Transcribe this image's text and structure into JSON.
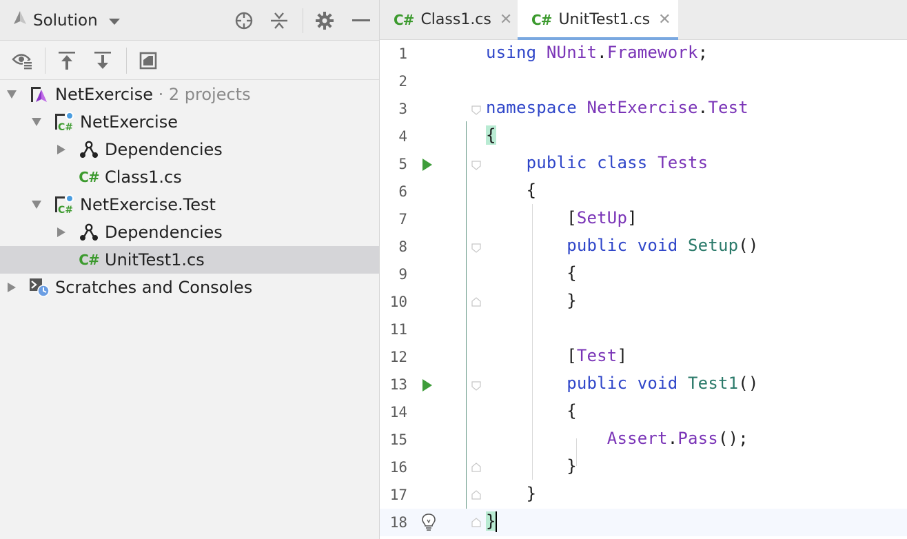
{
  "explorer": {
    "title": "Solution",
    "header_icons": [
      "locate-icon",
      "collapse-all-icon",
      "gear-icon",
      "minimize-icon"
    ],
    "toolbar_icons": [
      "show-options-icon",
      "move-up-icon",
      "move-down-icon",
      "preview-icon"
    ],
    "tree": [
      {
        "label": "NetExercise",
        "suffix": " · 2 projects",
        "icon": "solution-icon",
        "expanded": true
      },
      {
        "label": "NetExercise",
        "icon": "csharp-project-icon",
        "expanded": true
      },
      {
        "label": "Dependencies",
        "icon": "dependencies-icon",
        "expanded": false
      },
      {
        "label": "Class1.cs",
        "icon": "csharp-file-icon"
      },
      {
        "label": "NetExercise.Test",
        "icon": "csharp-project-icon",
        "expanded": true
      },
      {
        "label": "Dependencies",
        "icon": "dependencies-icon",
        "expanded": false
      },
      {
        "label": "UnitTest1.cs",
        "icon": "csharp-file-icon",
        "selected": true
      },
      {
        "label": "Scratches and Consoles",
        "icon": "scratches-icon",
        "expanded": false
      }
    ]
  },
  "editor": {
    "tabs": [
      {
        "icon_text": "C#",
        "label": "Class1.cs",
        "active": false
      },
      {
        "icon_text": "C#",
        "label": "UnitTest1.cs",
        "active": true
      }
    ],
    "line_numbers": [
      "1",
      "2",
      "3",
      "4",
      "5",
      "6",
      "7",
      "8",
      "9",
      "10",
      "11",
      "12",
      "13",
      "14",
      "15",
      "16",
      "17",
      "18"
    ],
    "run_markers_on_lines": [
      5,
      13
    ],
    "intention_bulb_on_line": 18,
    "code": {
      "l1_kw": "using",
      "l1_ns": "NUnit",
      "l1_dot": ".",
      "l1_ns2": "Framework",
      "l1_end": ";",
      "l3_kw": "namespace",
      "l3_ns": "NetExercise",
      "l3_dot": ".",
      "l3_ns2": "Test",
      "l4": "{",
      "l5_kw": "public class",
      "l5_ty": "Tests",
      "l6": "{",
      "l7_open": "[",
      "l7_attr": "SetUp",
      "l7_close": "]",
      "l8_kw": "public void",
      "l8_fn": "Setup",
      "l8_end": "()",
      "l9": "{",
      "l10": "}",
      "l12_open": "[",
      "l12_attr": "Test",
      "l12_close": "]",
      "l13_kw": "public void",
      "l13_fn": "Test1",
      "l13_end": "()",
      "l14": "{",
      "l15_ty": "Assert",
      "l15_dot": ".",
      "l15_fn": "Pass",
      "l15_end": "();",
      "l16": "}",
      "l17": "}",
      "l18": "}"
    }
  },
  "colors": {
    "keyword": "#2f46c9",
    "type": "#7a34b7",
    "method": "#2b7a6a",
    "csharp_icon": "#3c9a2e",
    "run_marker": "#3e9d3a",
    "brace_highlight": "#b9ebd3",
    "selection": "#d5d5d8"
  }
}
